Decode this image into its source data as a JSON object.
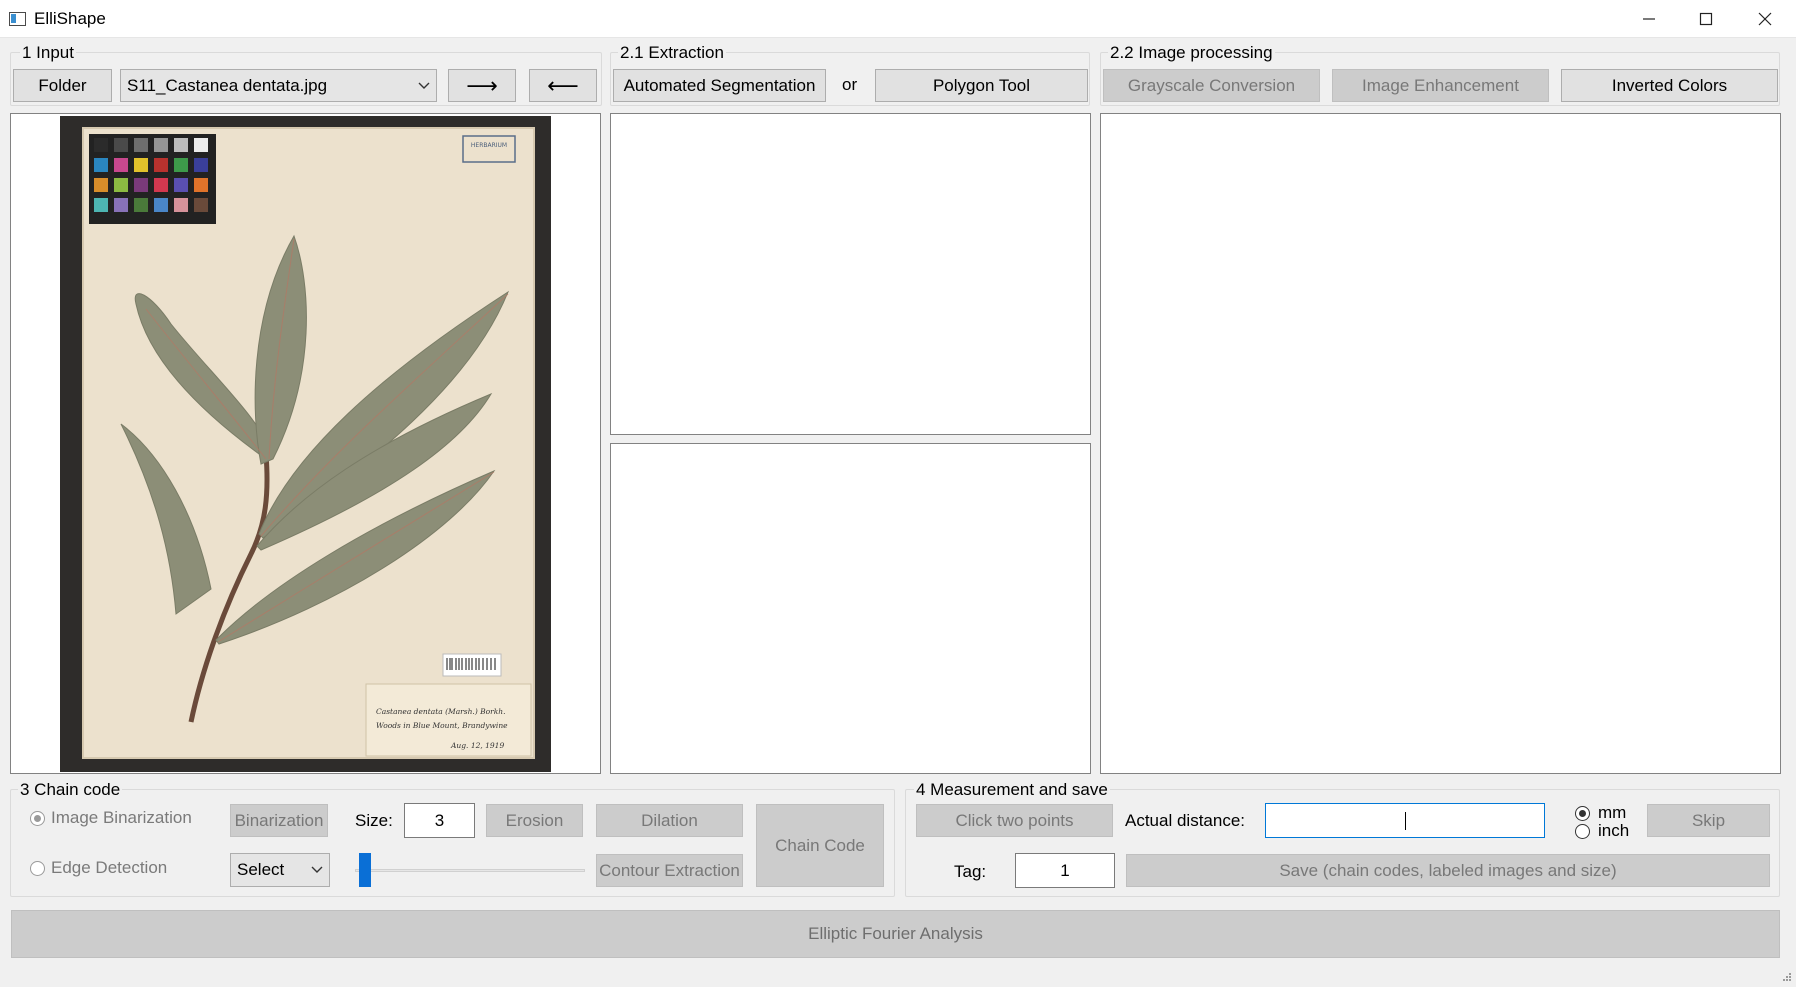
{
  "window": {
    "title": "ElliShape"
  },
  "input": {
    "group_title": "1 Input",
    "folder_label": "Folder",
    "file_select": "S11_Castanea dentata.jpg",
    "next_label": "⟶",
    "prev_label": "⟵"
  },
  "extraction": {
    "group_title": "2.1 Extraction",
    "auto_seg_label": "Automated Segmentation",
    "or_label": "or",
    "polygon_label": "Polygon Tool"
  },
  "processing": {
    "group_title": "2.2 Image processing",
    "grayscale_label": "Grayscale Conversion",
    "enhancement_label": "Image Enhancement",
    "invert_label": "Inverted Colors"
  },
  "chain": {
    "group_title": "3 Chain code",
    "binarization_radio": "Image Binarization",
    "edge_radio": "Edge Detection",
    "binarization_label": "Binarization",
    "size_label": "Size:",
    "size_value": "3",
    "erosion_label": "Erosion",
    "dilation_label": "Dilation",
    "edge_select": "Select",
    "contour_label": "Contour Extraction",
    "chaincode_label": "Chain Code",
    "slider_value": 0.02
  },
  "measure": {
    "group_title": "4 Measurement and save",
    "click_points_label": "Click two points",
    "distance_label": "Actual distance:",
    "distance_value": "",
    "unit_mm": "mm",
    "unit_inch": "inch",
    "skip_label": "Skip",
    "tag_label": "Tag:",
    "tag_value": "1",
    "save_label": "Save (chain codes, labeled images and size)"
  },
  "efa": {
    "label": "Elliptic Fourier Analysis"
  },
  "herbarium": {
    "stamp_text": "HERBARIUM",
    "label_line1": "Castanea dentata (Marsh.) Borkh.",
    "label_line2": "Woods in Blue Mount, Brandywine",
    "label_date": "Aug. 12, 1919",
    "color_chart": [
      "#2b2b2b",
      "#4a4a4a",
      "#6e6e6e",
      "#959595",
      "#bdbdbd",
      "#ececec",
      "#2a86c0",
      "#c8488e",
      "#e2c22b",
      "#b8322e",
      "#3d9a4a",
      "#3a3f9a",
      "#d88d2a",
      "#8cbb42",
      "#7a3a7a",
      "#d2384f",
      "#5a4fb0",
      "#e0732a",
      "#4db5b2",
      "#8872b8",
      "#4a7a3a",
      "#4a86c8",
      "#d6929a",
      "#6a4a3a"
    ]
  }
}
